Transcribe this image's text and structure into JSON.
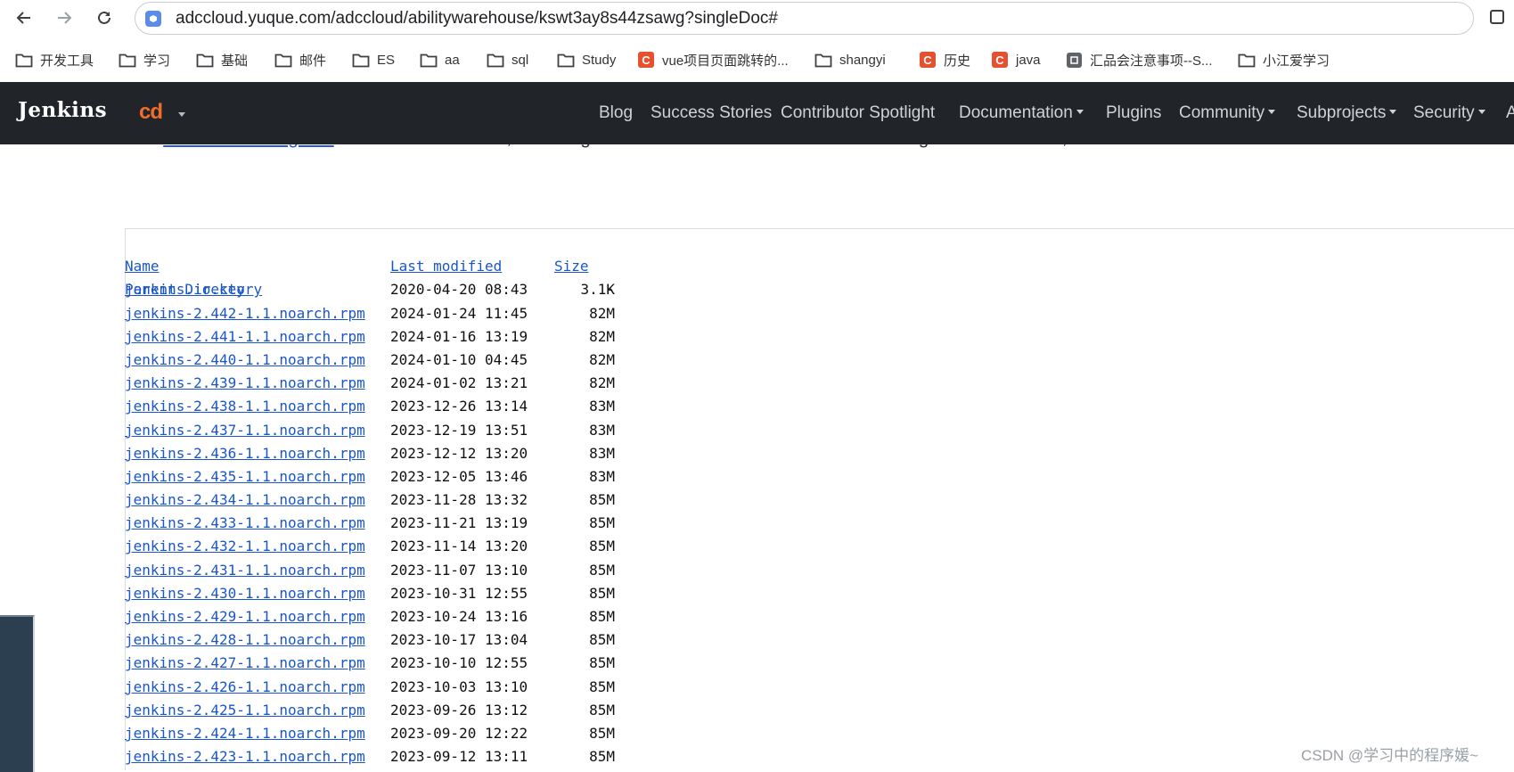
{
  "browser": {
    "url": "adccloud.yuque.com/adccloud/abilitywarehouse/kswt3ay8s44zsawg?singleDoc#",
    "bookmarks": [
      {
        "label": "开发工具",
        "icon": "folder-icon"
      },
      {
        "label": "学习",
        "icon": "folder-icon"
      },
      {
        "label": "基础",
        "icon": "folder-icon"
      },
      {
        "label": "邮件",
        "icon": "folder-icon"
      },
      {
        "label": "ES",
        "icon": "folder-icon"
      },
      {
        "label": "aa",
        "icon": "folder-icon"
      },
      {
        "label": "sql",
        "icon": "folder-icon"
      },
      {
        "label": "Study",
        "icon": "folder-icon"
      },
      {
        "label": "vue项目页面跳转的...",
        "icon": "csdn-icon"
      },
      {
        "label": "shangyi",
        "icon": "folder-icon"
      },
      {
        "label": "历史",
        "icon": "csdn-icon"
      },
      {
        "label": "java",
        "icon": "csdn-icon"
      },
      {
        "label": "汇品会注意事项--S...",
        "icon": "doc-icon"
      },
      {
        "label": "小江爱学习",
        "icon": "folder-icon"
      }
    ]
  },
  "jenkins_nav": {
    "logo": "Jenkins",
    "cd_logo": "cd",
    "links": [
      {
        "label": "Blog",
        "dropdown": false
      },
      {
        "label": "Success Stories",
        "dropdown": false
      },
      {
        "label": "Contributor Spotlight",
        "dropdown": false
      },
      {
        "label": "Documentation",
        "dropdown": true
      },
      {
        "label": "Plugins",
        "dropdown": false
      },
      {
        "label": "Community",
        "dropdown": true
      },
      {
        "label": "Subprojects",
        "dropdown": true
      },
      {
        "label": "Security",
        "dropdown": true
      },
      {
        "label": "A",
        "dropdown": false
      }
    ]
  },
  "intro": {
    "prefix": "See ",
    "link": "the installation guide",
    "suffix": " for more information, including how Jenkins is run and where the configuration is stored, etc."
  },
  "listing": {
    "headers": {
      "name": "Name",
      "modified": "Last modified",
      "size": "Size"
    },
    "parent": {
      "name": "Parent Directory",
      "size": "-"
    },
    "rows": [
      {
        "name": "jenkins.io.key",
        "date": "2020-04-20 08:43",
        "size": "3.1K"
      },
      {
        "name": "jenkins-2.442-1.1.noarch.rpm",
        "date": "2024-01-24 11:45",
        "size": "82M"
      },
      {
        "name": "jenkins-2.441-1.1.noarch.rpm",
        "date": "2024-01-16 13:19",
        "size": "82M"
      },
      {
        "name": "jenkins-2.440-1.1.noarch.rpm",
        "date": "2024-01-10 04:45",
        "size": "82M"
      },
      {
        "name": "jenkins-2.439-1.1.noarch.rpm",
        "date": "2024-01-02 13:21",
        "size": "82M"
      },
      {
        "name": "jenkins-2.438-1.1.noarch.rpm",
        "date": "2023-12-26 13:14",
        "size": "83M"
      },
      {
        "name": "jenkins-2.437-1.1.noarch.rpm",
        "date": "2023-12-19 13:51",
        "size": "83M"
      },
      {
        "name": "jenkins-2.436-1.1.noarch.rpm",
        "date": "2023-12-12 13:20",
        "size": "83M"
      },
      {
        "name": "jenkins-2.435-1.1.noarch.rpm",
        "date": "2023-12-05 13:46",
        "size": "83M"
      },
      {
        "name": "jenkins-2.434-1.1.noarch.rpm",
        "date": "2023-11-28 13:32",
        "size": "85M"
      },
      {
        "name": "jenkins-2.433-1.1.noarch.rpm",
        "date": "2023-11-21 13:19",
        "size": "85M"
      },
      {
        "name": "jenkins-2.432-1.1.noarch.rpm",
        "date": "2023-11-14 13:20",
        "size": "85M"
      },
      {
        "name": "jenkins-2.431-1.1.noarch.rpm",
        "date": "2023-11-07 13:10",
        "size": "85M"
      },
      {
        "name": "jenkins-2.430-1.1.noarch.rpm",
        "date": "2023-10-31 12:55",
        "size": "85M"
      },
      {
        "name": "jenkins-2.429-1.1.noarch.rpm",
        "date": "2023-10-24 13:16",
        "size": "85M"
      },
      {
        "name": "jenkins-2.428-1.1.noarch.rpm",
        "date": "2023-10-17 13:04",
        "size": "85M"
      },
      {
        "name": "jenkins-2.427-1.1.noarch.rpm",
        "date": "2023-10-10 12:55",
        "size": "85M"
      },
      {
        "name": "jenkins-2.426-1.1.noarch.rpm",
        "date": "2023-10-03 13:10",
        "size": "85M"
      },
      {
        "name": "jenkins-2.425-1.1.noarch.rpm",
        "date": "2023-09-26 13:12",
        "size": "85M"
      },
      {
        "name": "jenkins-2.424-1.1.noarch.rpm",
        "date": "2023-09-20 12:22",
        "size": "85M"
      },
      {
        "name": "jenkins-2.423-1.1.noarch.rpm",
        "date": "2023-09-12 13:11",
        "size": "85M"
      }
    ]
  },
  "watermark": "CSDN @学习中的程序媛~",
  "colors": {
    "navbar_bg": "#212529",
    "link_blue": "#1a56c8",
    "cd_orange": "#f26c2a",
    "csdn_red": "#e7502f"
  }
}
